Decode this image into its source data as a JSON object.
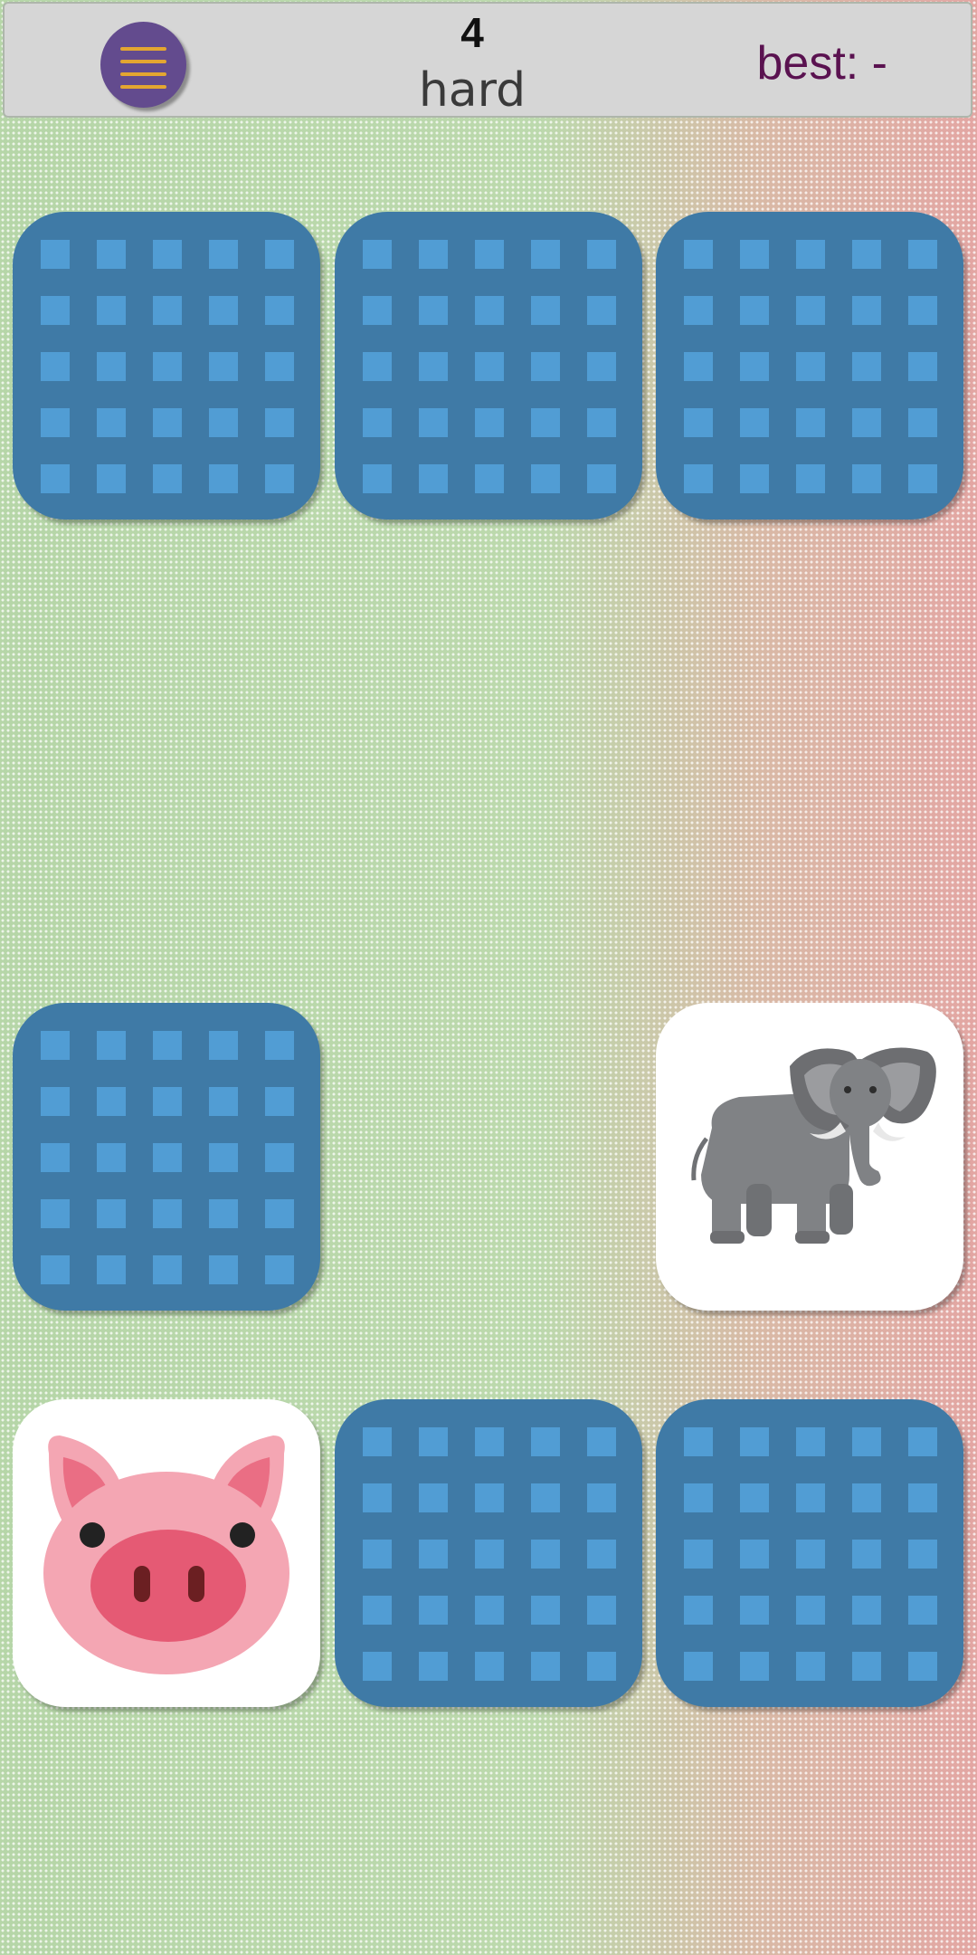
{
  "header": {
    "moves": "4",
    "level": "hard",
    "best": "best: -",
    "menu_icon": "hamburger-icon"
  },
  "board": {
    "rows": 4,
    "cols": 3,
    "cards": [
      {
        "state": "face-down"
      },
      {
        "state": "face-down"
      },
      {
        "state": "face-down"
      },
      {
        "state": "matched"
      },
      {
        "state": "matched"
      },
      {
        "state": "matched"
      },
      {
        "state": "face-down"
      },
      {
        "state": "matched"
      },
      {
        "state": "face-up",
        "icon": "elephant-icon"
      },
      {
        "state": "face-up",
        "icon": "pig-face-icon"
      },
      {
        "state": "face-down"
      },
      {
        "state": "face-down"
      }
    ]
  },
  "colors": {
    "card_back": "#3f7aa6",
    "card_back_square": "#519dd4",
    "menu_button": "#634b8e",
    "menu_lines": "#e3a631",
    "best_text": "#5a1250"
  }
}
